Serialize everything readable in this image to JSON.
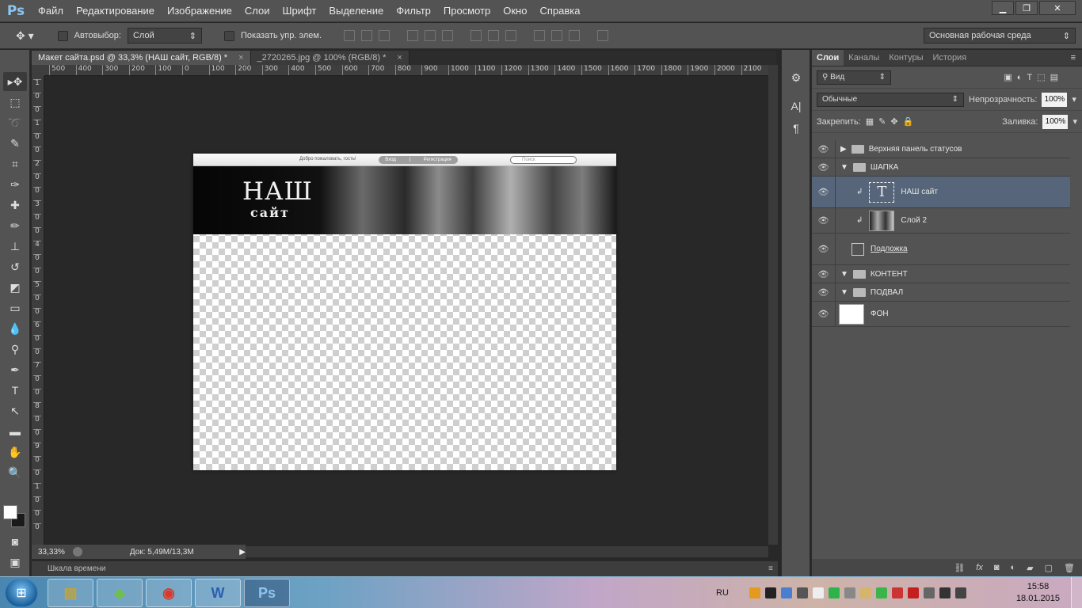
{
  "app": {
    "logo": "Ps"
  },
  "menu": [
    "Файл",
    "Редактирование",
    "Изображение",
    "Слои",
    "Шрифт",
    "Выделение",
    "Фильтр",
    "Просмотр",
    "Окно",
    "Справка"
  ],
  "window_controls": {
    "minimize": "▁",
    "restore": "❐",
    "close": "✕"
  },
  "options": {
    "auto_select_label": "Автовыбор:",
    "auto_select_value": "Слой",
    "show_controls_label": "Показать упр. элем.",
    "workspace": "Основная рабочая среда"
  },
  "tabs": [
    {
      "label": "Макет сайта.psd @ 33,3% (НАШ сайт, RGB/8) *",
      "close": "×"
    },
    {
      "label": "_2720265.jpg @ 100% (RGB/8) *",
      "close": "×"
    }
  ],
  "ruler_top": [
    "500",
    "400",
    "300",
    "200",
    "100",
    "0",
    "100",
    "200",
    "300",
    "400",
    "500",
    "600",
    "700",
    "800",
    "900",
    "1000",
    "1100",
    "1200",
    "1300",
    "1400",
    "1500",
    "1600",
    "1700",
    "1800",
    "1900",
    "2000",
    "2100"
  ],
  "ruler_left": [
    "1",
    "0",
    "0",
    "1",
    "0",
    "0",
    "2",
    "0",
    "0",
    "3",
    "0",
    "0",
    "4",
    "0",
    "0",
    "5",
    "0",
    "0",
    "6",
    "0",
    "0",
    "7",
    "0",
    "0",
    "8",
    "0",
    "0",
    "9",
    "0",
    "0",
    "1",
    "0",
    "0",
    "0"
  ],
  "canvas": {
    "welcome": "Добро пожаловать, гость!",
    "login": "Вход",
    "register": "Регистрация",
    "search": "Поиск",
    "title": "НАШ",
    "subtitle": "сайт"
  },
  "status": {
    "zoom": "33,33%",
    "doc": "Док: 5,49M/13,3M"
  },
  "timeline_label": "Шкала времени",
  "panel_tabs": [
    "Слои",
    "Каналы",
    "Контуры",
    "История"
  ],
  "layers_panel": {
    "filter": "Вид",
    "blend_mode": "Обычные",
    "opacity_label": "Непрозрачность:",
    "opacity": "100%",
    "lock_label": "Закрепить:",
    "fill_label": "Заливка:",
    "fill": "100%"
  },
  "layers": [
    {
      "name": "Верхняя панель статусов",
      "kind": "group-collapsed"
    },
    {
      "name": "ШАПКА",
      "kind": "group-open"
    },
    {
      "name": "НАШ сайт",
      "kind": "text",
      "selected": true
    },
    {
      "name": "Слой 2",
      "kind": "image"
    },
    {
      "name": "Подложка",
      "kind": "shape"
    },
    {
      "name": "КОНТЕНТ",
      "kind": "group-open"
    },
    {
      "name": "ПОДВАЛ",
      "kind": "group-open"
    },
    {
      "name": "ФОН",
      "kind": "background"
    }
  ],
  "taskbar": {
    "language": "RU",
    "time": "15:58",
    "date": "18.01.2015"
  },
  "colors": {
    "accent_selected_layer": "#56657a",
    "panel_bg": "#535353",
    "canvas_bg": "#282828"
  }
}
